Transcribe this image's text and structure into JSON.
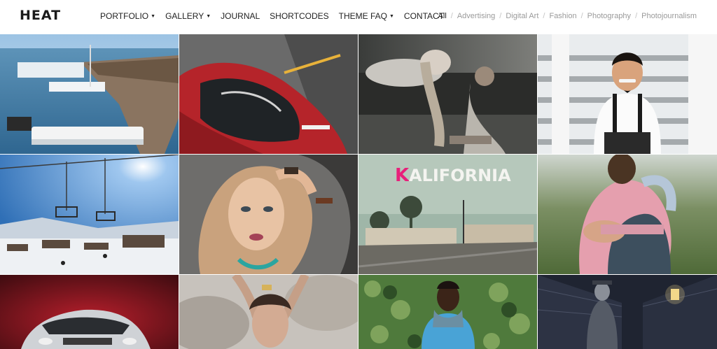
{
  "header": {
    "logo": "HEAT",
    "nav": [
      {
        "label": "PORTFOLIO",
        "dropdown": true
      },
      {
        "label": "GALLERY",
        "dropdown": true
      },
      {
        "label": "JOURNAL",
        "dropdown": false
      },
      {
        "label": "SHORTCODES",
        "dropdown": false
      },
      {
        "label": "THEME FAQ",
        "dropdown": true
      },
      {
        "label": "CONTACT",
        "dropdown": false
      }
    ],
    "caret": "▼"
  },
  "filters": {
    "items": [
      "All",
      "Advertising",
      "Digital Art",
      "Fashion",
      "Photography",
      "Photojournalism"
    ],
    "active": "All",
    "separator": "/"
  },
  "tiles": [
    {
      "name": "harbor-boats-photo"
    },
    {
      "name": "red-sports-car-photo"
    },
    {
      "name": "reclining-women-photo"
    },
    {
      "name": "man-suspenders-stairs-photo"
    },
    {
      "name": "ski-lift-photo"
    },
    {
      "name": "blonde-woman-portrait-photo"
    },
    {
      "name": "kalifornia-street-photo",
      "overlay_text_k": "K",
      "overlay_text_rest": "ALIFORNIA"
    },
    {
      "name": "couple-embrace-photo"
    },
    {
      "name": "red-car-ad-photo"
    },
    {
      "name": "woman-arms-raised-photo"
    },
    {
      "name": "man-scarf-ivy-photo"
    },
    {
      "name": "dark-alley-figure-photo"
    }
  ],
  "colors": {
    "accent_pink": "#e8207a",
    "header_bg": "#ffffff",
    "nav_text": "#222222",
    "filter_inactive": "#9a9a9a"
  }
}
